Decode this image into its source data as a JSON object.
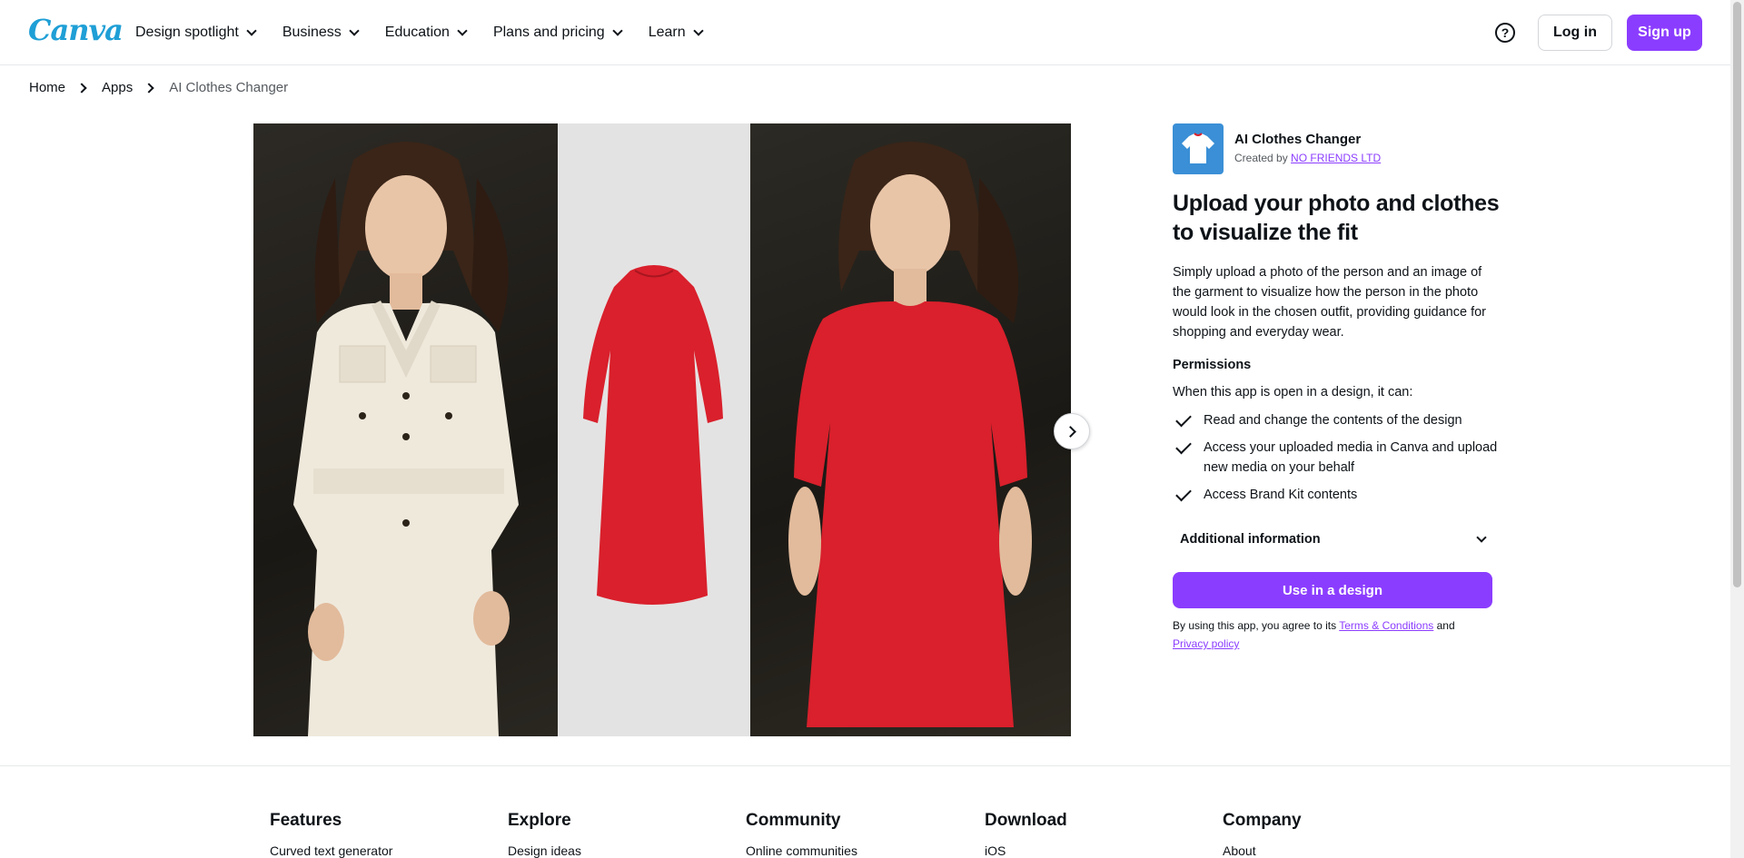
{
  "header": {
    "logo": "Canva",
    "nav": [
      {
        "label": "Design spotlight"
      },
      {
        "label": "Business"
      },
      {
        "label": "Education"
      },
      {
        "label": "Plans and pricing"
      },
      {
        "label": "Learn"
      }
    ],
    "help_glyph": "?",
    "login_label": "Log in",
    "signup_label": "Sign up"
  },
  "breadcrumb": [
    "Home",
    "Apps",
    "AI Clothes Changer"
  ],
  "app": {
    "name": "AI Clothes Changer",
    "created_by_prefix": "Created by",
    "creator": "NO FRIENDS LTD",
    "icon": "shirt-icon"
  },
  "main": {
    "headline": "Upload your photo and clothes to visualize the fit",
    "description": "Simply upload a photo of the person and an image of the garment to visualize how the person in the photo would look in the chosen outfit, providing guidance for shopping and everyday wear.",
    "permissions_title": "Permissions",
    "permissions_intro": "When this app is open in a design, it can:",
    "permissions": [
      "Read and change the contents of the design",
      "Access your uploaded media in Canva and upload new media on your behalf",
      "Access Brand Kit contents"
    ],
    "additional_info": "Additional information",
    "use_button": "Use in a design",
    "terms_prefix": "By using this app, you agree to its",
    "terms_link": "Terms & Conditions",
    "terms_and": "and",
    "privacy_link": "Privacy policy"
  },
  "colors": {
    "accent": "#8b3dff",
    "dress_red": "#d9202c",
    "jumpsuit_cream": "#efe9dc"
  },
  "footer": [
    {
      "title": "Features",
      "first": "Curved text generator"
    },
    {
      "title": "Explore",
      "first": "Design ideas"
    },
    {
      "title": "Community",
      "first": "Online communities"
    },
    {
      "title": "Download",
      "first": "iOS"
    },
    {
      "title": "Company",
      "first": "About"
    }
  ]
}
